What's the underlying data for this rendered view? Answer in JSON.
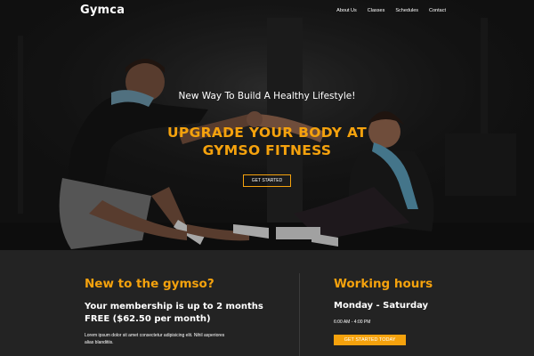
{
  "nav": {
    "brand": "Gymca",
    "links": [
      "About Us",
      "Classes",
      "Schedules",
      "Contact"
    ]
  },
  "hero": {
    "tagline": "New Way To Build A Healthy Lifestyle!",
    "headline_line1": "UPGRADE YOUR BODY AT",
    "headline_line2": "GYMSO FITNESS",
    "cta_label": "GET STARTED"
  },
  "info": {
    "left": {
      "title": "New to the gymso?",
      "membership_line1": "Your membership is up to 2 months",
      "membership_line2": "FREE ($62.50 per month)",
      "body_line1": "Lorem ipsum dolor sit amet consectetur adipisicing elit. Nihil asperiores",
      "body_line2": "alias blanditiis."
    },
    "right": {
      "title": "Working hours",
      "days": "Monday - Saturday",
      "hours": "6:00 AM - 4:00 PM",
      "cta_label": "GET STARTED TODAY"
    }
  },
  "colors": {
    "accent": "#f5a20d",
    "background": "#232323",
    "text": "#ffffff"
  }
}
